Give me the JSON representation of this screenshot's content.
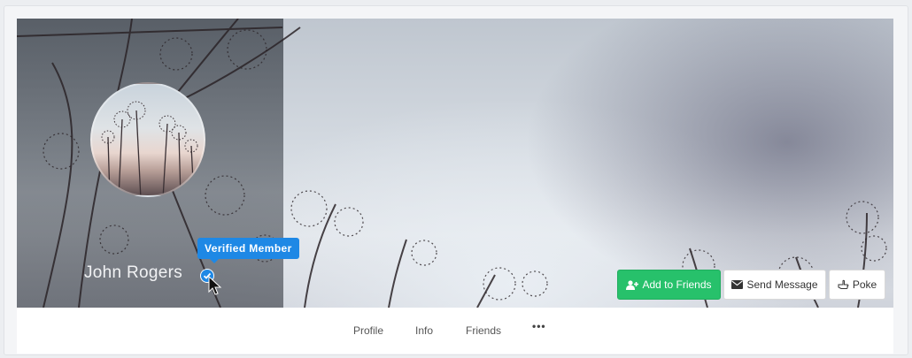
{
  "profile": {
    "name": "John Rogers",
    "verified_tooltip": "Verified Member",
    "icons": {
      "verified": "check-circle-icon",
      "cursor": "mouse-pointer-icon"
    }
  },
  "actions": {
    "add_friends": {
      "label": "Add to Friends",
      "icon": "user-plus-icon",
      "color": "#27c16b"
    },
    "send_message": {
      "label": "Send Message",
      "icon": "envelope-icon"
    },
    "poke": {
      "label": "Poke",
      "icon": "pointing-hand-icon"
    }
  },
  "nav": {
    "items": [
      "Profile",
      "Info",
      "Friends"
    ],
    "more": "•••"
  },
  "colors": {
    "accent_blue": "#1e88e5",
    "add_green": "#27c16b"
  }
}
